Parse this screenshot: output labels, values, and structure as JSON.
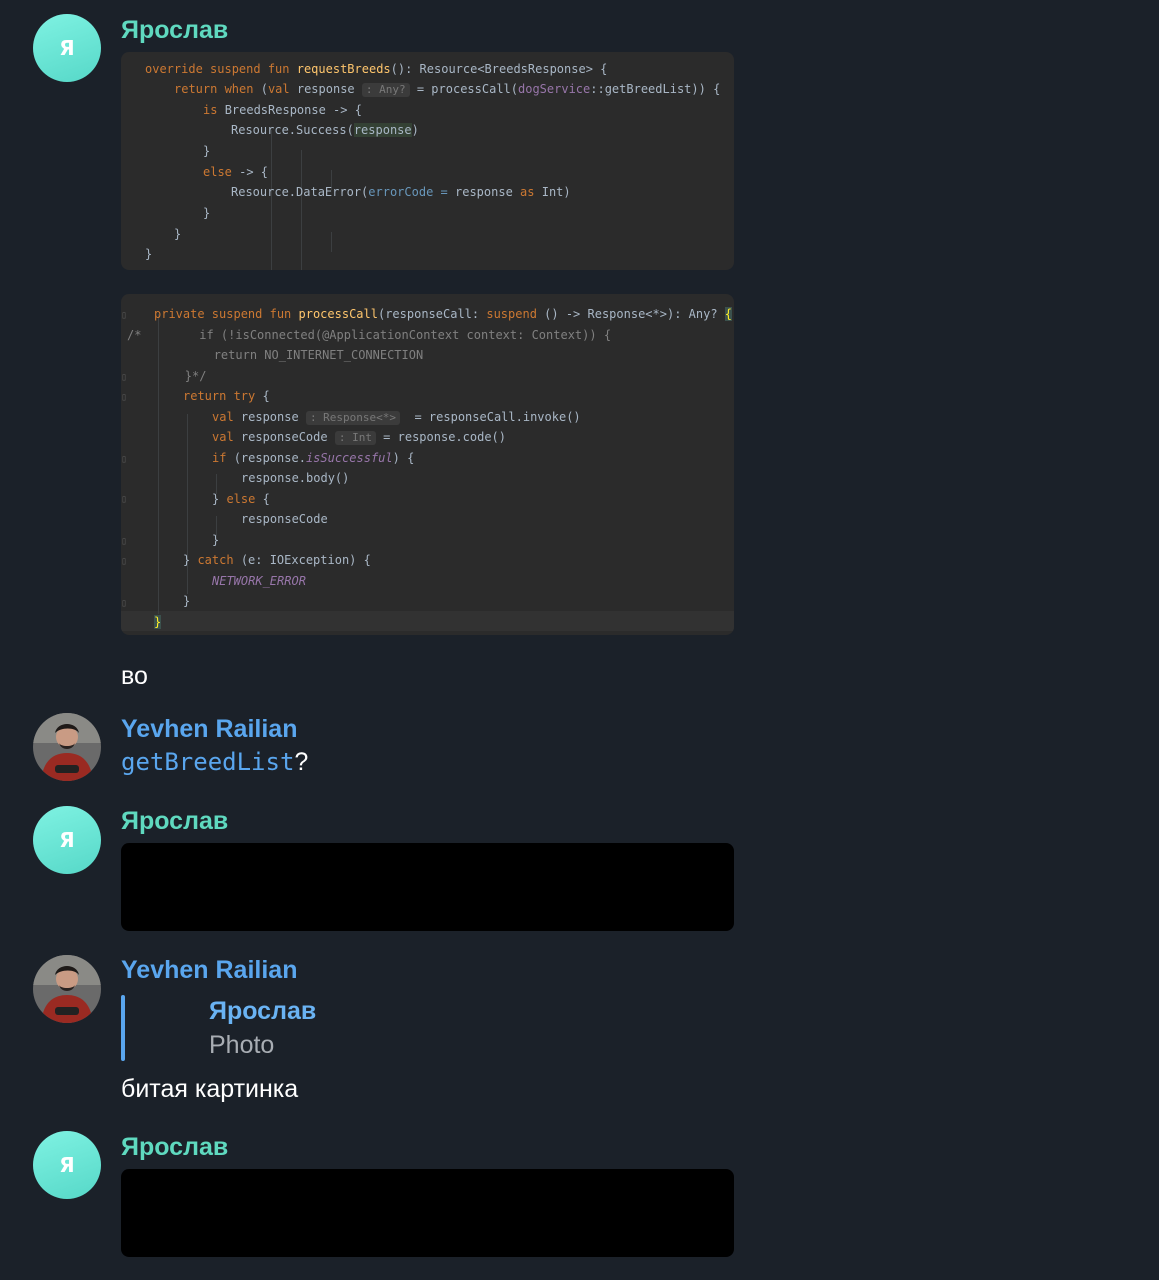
{
  "users": {
    "yaroslav": {
      "name": "Ярослав",
      "initial": "Я",
      "color": "#5fd9bf"
    },
    "yevhen": {
      "name": "Yevhen Railian",
      "color": "#5aa6ee"
    }
  },
  "messages": [
    {
      "sender": "Ярослав",
      "type": "code-image",
      "id": "code1"
    },
    {
      "sender": "Ярослав",
      "type": "code-image",
      "id": "code2"
    },
    {
      "sender": "Ярослав",
      "type": "text",
      "text": "во"
    },
    {
      "sender": "Yevhen Railian",
      "type": "text",
      "code": "getBreedList",
      "suffix": "?"
    },
    {
      "sender": "Ярослав",
      "type": "media"
    },
    {
      "sender": "Yevhen Railian",
      "type": "reply",
      "reply_to": {
        "name": "Ярослав",
        "text": "Photo"
      },
      "text": "битая картинка"
    },
    {
      "sender": "Ярослав",
      "type": "media"
    }
  ],
  "code1": {
    "l1a": "override suspend fun ",
    "l1b": "requestBreeds",
    "l1c": "(): Resource<BreedsResponse> {",
    "l2a": "return when ",
    "l2b": "(",
    "l2c": "val ",
    "l2d": "response ",
    "l2hint": ": Any?",
    "l2e": " = processCall(",
    "l2f": "dogService",
    "l2g": "::getBreedList)) {",
    "l3a": "is ",
    "l3b": "BreedsResponse -> {",
    "l4a": "Resource.Success(",
    "l4b": "response",
    "l4c": ")",
    "l5": "}",
    "l6a": "else ",
    "l6b": "-> {",
    "l7a": "Resource.DataError(",
    "l7b": "errorCode",
    "l7c": " = ",
    "l7d": "response ",
    "l7e": "as ",
    "l7f": "Int)",
    "l8": "}",
    "l9": "}",
    "l10": "}"
  },
  "code2": {
    "l1a": "private suspend fun ",
    "l1b": "processCall",
    "l1c": "(responseCall: ",
    "l1d": "suspend ",
    "l1e": "() -> Response<*>): Any? ",
    "l1f": "{",
    "l2": "/*        if (!isConnected(@ApplicationContext context: Context)) {",
    "l3": "            return NO_INTERNET_CONNECTION",
    "l4": "        }*/",
    "l5a": "return try ",
    "l5b": "{",
    "l6a": "val ",
    "l6b": "response ",
    "l6hint": ": Response<*>",
    "l6c": "  = responseCall.invoke()",
    "l7a": "val ",
    "l7b": "responseCode ",
    "l7hint": ": Int",
    "l7c": " = response.code()",
    "l8a": "if ",
    "l8b": "(response.",
    "l8c": "isSuccessful",
    "l8d": ") {",
    "l9": "response.body()",
    "l10a": "} ",
    "l10b": "else ",
    "l10c": "{",
    "l11": "responseCode",
    "l12": "}",
    "l13a": "} ",
    "l13b": "catch ",
    "l13c": "(e: IOException) {",
    "l14": "NETWORK_ERROR",
    "l15": "}",
    "l16": "}"
  }
}
